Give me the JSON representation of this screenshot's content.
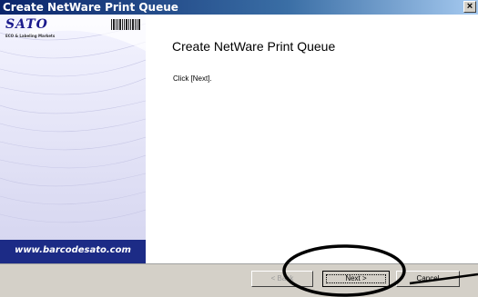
{
  "window": {
    "title": "Create NetWare Print Queue",
    "close_glyph": "×"
  },
  "sidebar": {
    "logo": "SATO",
    "tagline": "ECO & Labeling Markets",
    "url": "www.barcodesato.com",
    "band_color": "#1c2b86"
  },
  "main": {
    "title": "Create NetWare Print Queue",
    "instruction": "Click [Next]."
  },
  "buttons": {
    "back": "< Back",
    "next": "Next >",
    "cancel": "Cancel"
  },
  "icons": {
    "close": "close-icon",
    "barcode": "barcode-icon"
  },
  "annotation": {
    "shape": "ellipse-highlight",
    "target": "next-button",
    "color": "#000000"
  }
}
